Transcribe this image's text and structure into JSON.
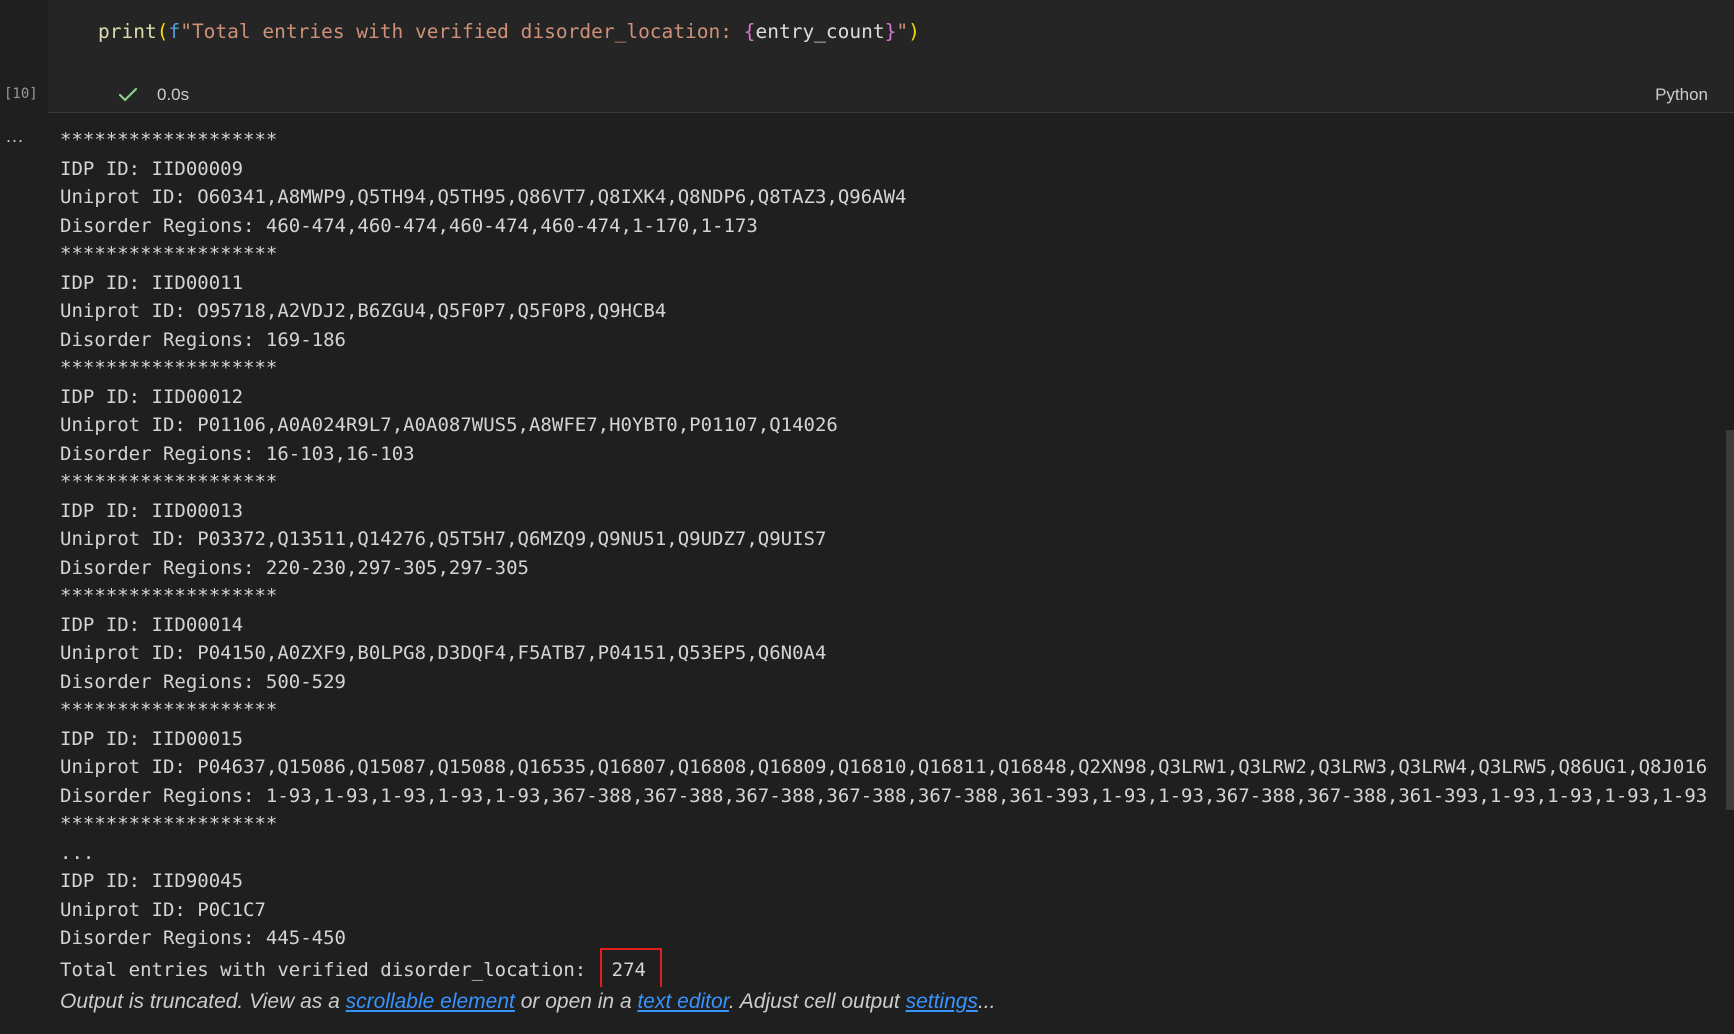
{
  "cell": {
    "code": {
      "fn": "print",
      "paren_open": "(",
      "fprefix": "f",
      "str_start": "\"Total entries with verified disorder_location: ",
      "brace_open": "{",
      "var": "entry_count",
      "brace_close": "}",
      "str_end": "\"",
      "paren_close": ")"
    },
    "exec_count": "[10]",
    "exec_time": "0.0s",
    "language": "Python"
  },
  "output": {
    "more_label": "...",
    "lines": [
      "*******************",
      "IDP ID: IID00009",
      "Uniprot ID: O60341,A8MWP9,Q5TH94,Q5TH95,Q86VT7,Q8IXK4,Q8NDP6,Q8TAZ3,Q96AW4",
      "Disorder Regions: 460-474,460-474,460-474,460-474,1-170,1-173",
      "*******************",
      "IDP ID: IID00011",
      "Uniprot ID: O95718,A2VDJ2,B6ZGU4,Q5F0P7,Q5F0P8,Q9HCB4",
      "Disorder Regions: 169-186",
      "*******************",
      "IDP ID: IID00012",
      "Uniprot ID: P01106,A0A024R9L7,A0A087WUS5,A8WFE7,H0YBT0,P01107,Q14026",
      "Disorder Regions: 16-103,16-103",
      "*******************",
      "IDP ID: IID00013",
      "Uniprot ID: P03372,Q13511,Q14276,Q5T5H7,Q6MZQ9,Q9NU51,Q9UDZ7,Q9UIS7",
      "Disorder Regions: 220-230,297-305,297-305",
      "*******************",
      "IDP ID: IID00014",
      "Uniprot ID: P04150,A0ZXF9,B0LPG8,D3DQF4,F5ATB7,P04151,Q53EP5,Q6N0A4",
      "Disorder Regions: 500-529",
      "*******************",
      "IDP ID: IID00015",
      "Uniprot ID: P04637,Q15086,Q15087,Q15088,Q16535,Q16807,Q16808,Q16809,Q16810,Q16811,Q16848,Q2XN98,Q3LRW1,Q3LRW2,Q3LRW3,Q3LRW4,Q3LRW5,Q86UG1,Q8J016",
      "Disorder Regions: 1-93,1-93,1-93,1-93,1-93,367-388,367-388,367-388,367-388,367-388,361-393,1-93,1-93,367-388,367-388,361-393,1-93,1-93,1-93,1-93",
      "*******************",
      "...",
      "IDP ID: IID90045",
      "Uniprot ID: P0C1C7",
      "Disorder Regions: 445-450"
    ],
    "total_label": "Total entries with verified disorder_location: ",
    "total_count": "274"
  },
  "truncation": {
    "text1": "Output is truncated. View as a ",
    "link1": "scrollable element",
    "text2": " or open in a ",
    "link2": "text editor",
    "text3": ". Adjust cell output ",
    "link3": "settings",
    "text4": "..."
  },
  "colors": {
    "background": "#1f1f1f",
    "cell_background": "#252526",
    "link": "#3794ff",
    "highlight_box": "#e02020",
    "success": "#89d185"
  },
  "icons": {
    "status": "check-icon"
  }
}
